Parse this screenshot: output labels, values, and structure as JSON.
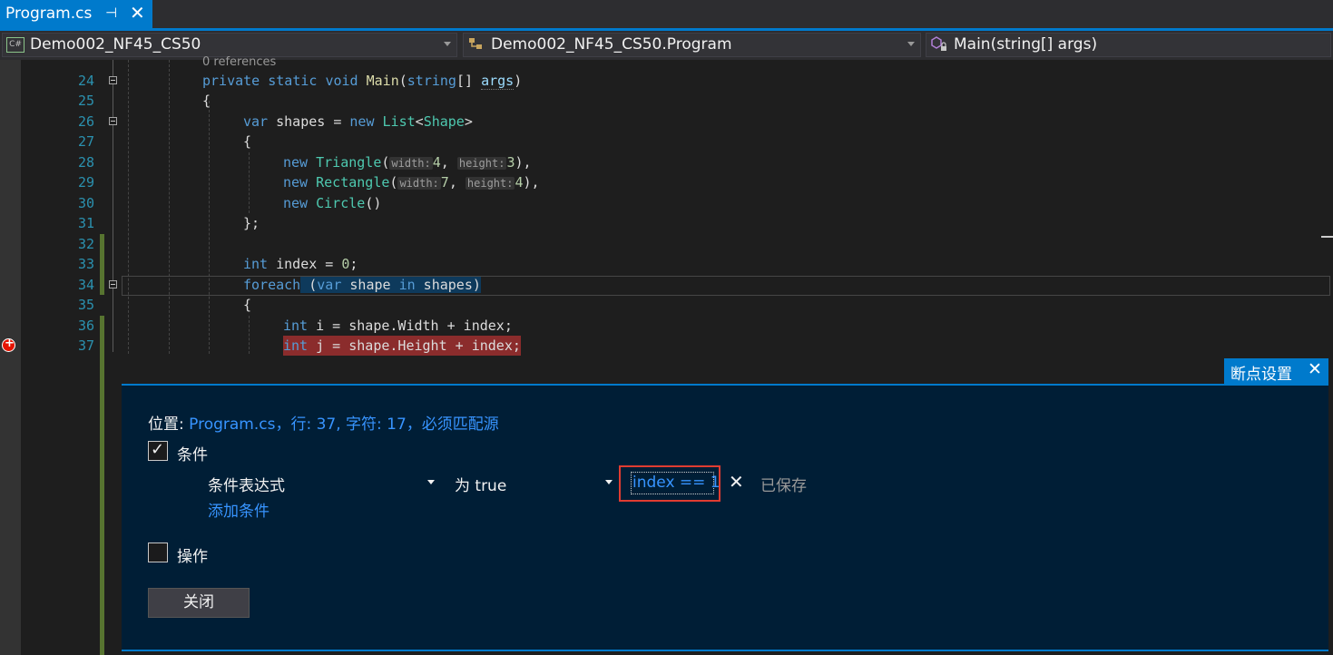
{
  "tab": {
    "title": "Program.cs",
    "pin": "⊣",
    "close": "✕"
  },
  "navbar": {
    "project": "Demo002_NF45_CS50",
    "project_icon": "C#",
    "class": "Demo002_NF45_CS50.Program",
    "member": "Main(string[] args)"
  },
  "editor": {
    "codelens": "0 references",
    "line_numbers": [
      "24",
      "25",
      "26",
      "27",
      "28",
      "29",
      "30",
      "31",
      "32",
      "33",
      "34",
      "35",
      "36",
      "37"
    ],
    "lines": {
      "l24_kw": "private static void ",
      "l24_method": "Main",
      "l24_a": "(",
      "l24_type": "string",
      "l24_b": "[] ",
      "l24_param": "args",
      "l24_c": ")",
      "l25": "{",
      "l26_kw": "var",
      "l26_a": " shapes = ",
      "l26_new": "new",
      "l26_b": " ",
      "l26_list": "List",
      "l26_c": "<",
      "l26_shape": "Shape",
      "l26_d": ">",
      "l27": "{",
      "l28_new": "new",
      "l28_type": "Triangle",
      "l28_h1": "width:",
      "l28_v1": "4",
      "l28_h2": "height:",
      "l28_v2": "3",
      "l29_new": "new",
      "l29_type": "Rectangle",
      "l29_h1": "width:",
      "l29_v1": "7",
      "l29_h2": "height:",
      "l29_v2": "4",
      "l30_new": "new",
      "l30_type": "Circle",
      "l30_a": "()",
      "l31": "};",
      "l33_kw": "int",
      "l33_a": " index = ",
      "l33_num": "0",
      "l33_b": ";",
      "l34_kw": "foreach",
      "l34_a": " (",
      "l34_var": "var",
      "l34_b": " shape ",
      "l34_in": "in",
      "l34_c": " shapes)",
      "l35": "{",
      "l36_kw": "int",
      "l36_a": " i = shape.Width + index;",
      "l37_kw": "int",
      "l37_a": " j = shape.Height + index;"
    }
  },
  "breakpoint_settings": {
    "header": "断点设置",
    "close": "✕",
    "location_label": "位置:",
    "location_value": "Program.cs，行: 37, 字符: 17，必须匹配源",
    "conditions_label": "条件",
    "conditions_checked": true,
    "condition_type": "条件表达式",
    "condition_mode": "为 true",
    "condition_expression": "index == 1",
    "remove": "✕",
    "saved_status": "已保存",
    "add_condition": "添加条件",
    "actions_label": "操作",
    "actions_checked": false,
    "close_button": "关闭"
  },
  "colors": {
    "accent": "#007acc",
    "panel_bg": "#001e36",
    "link": "#3794ff",
    "breakpoint": "#e51400",
    "highlight_border": "#e03c31"
  }
}
